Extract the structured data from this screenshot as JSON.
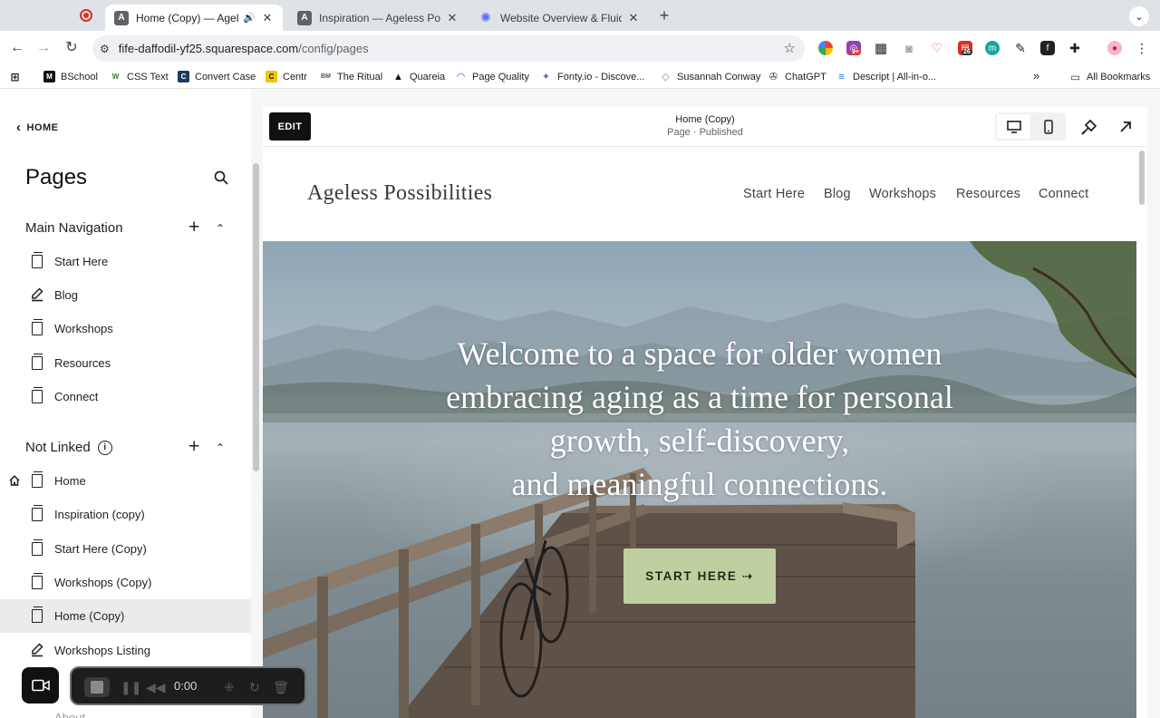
{
  "browser": {
    "tabs": [
      {
        "title": "Home (Copy) — Ageless P",
        "active": true
      },
      {
        "title": "Inspiration — Ageless Possibi",
        "active": false
      },
      {
        "title": "Website Overview & Fluid Eng",
        "active": false
      }
    ],
    "url_host": "fife-daffodil-yf25.squarespace.com",
    "url_path": "/config/pages",
    "ext_badge_1": "9+",
    "ext_badge_2": "26",
    "bookmarks": [
      "BSchool",
      "CSS Text",
      "Convert Case",
      "Centr",
      "The Ritual",
      "Quareia",
      "Page Quality",
      "Fonty.io - Discove...",
      "Susannah Conway",
      "ChatGPT",
      "Descript | All-in-o..."
    ],
    "bookmarks_more": "»",
    "all_bookmarks": "All Bookmarks"
  },
  "panel": {
    "back_label": "HOME",
    "title": "Pages",
    "main_nav_label": "Main Navigation",
    "main_nav_items": [
      "Start Here",
      "Blog",
      "Workshops",
      "Resources",
      "Connect"
    ],
    "not_linked_label": "Not Linked",
    "not_linked_items": [
      "Home",
      "Inspiration (copy)",
      "Start Here (Copy)",
      "Workshops (Copy)",
      "Home (Copy)",
      "Workshops Listing"
    ],
    "peek_item": "About"
  },
  "frame": {
    "edit_label": "EDIT",
    "page_title": "Home (Copy)",
    "page_status": "Page · Published"
  },
  "site": {
    "logo": "Ageless Possibilities",
    "nav": [
      "Start Here",
      "Blog",
      "Workshops",
      "Resources",
      "Connect"
    ],
    "hero_lines": [
      "Welcome to a space for older women",
      "embracing aging as a time for personal",
      "growth, self-discovery,",
      "and meaningful connections."
    ],
    "cta_label": "START HERE ⇢",
    "cta_color": "#bfcf9f"
  },
  "recorder": {
    "time": "0:00"
  }
}
